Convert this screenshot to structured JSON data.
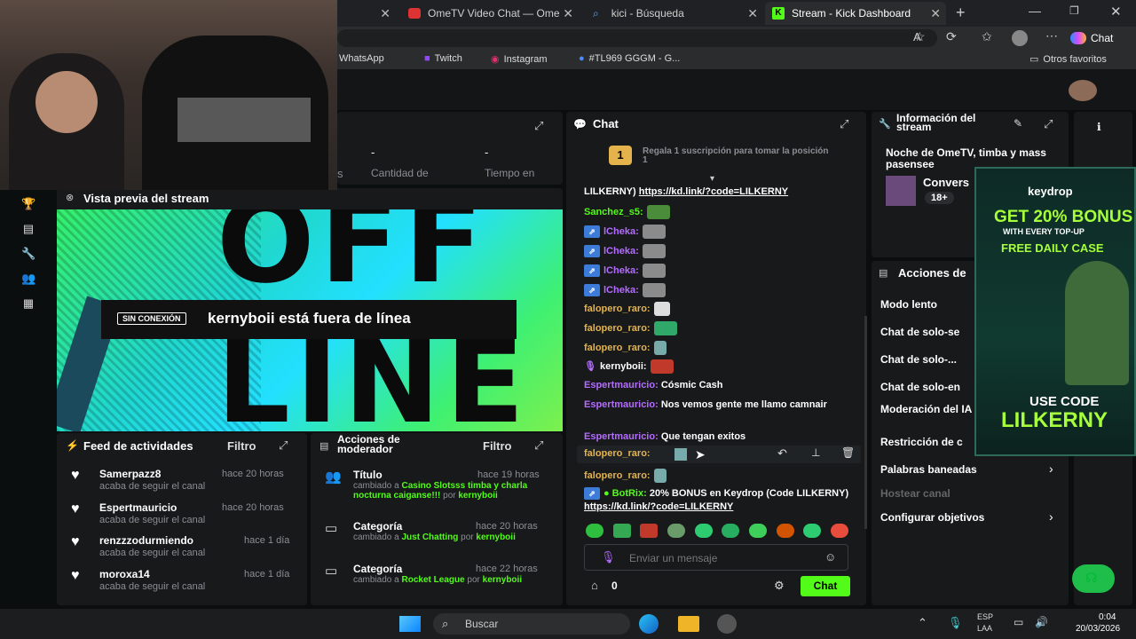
{
  "browser": {
    "tabs": [
      {
        "label": "",
        "active": false
      },
      {
        "label": "OmeTV Video Chat — Ome",
        "active": false
      },
      {
        "label": "kici - Búsqueda",
        "active": false
      },
      {
        "label": "Stream - Kick Dashboard",
        "active": true
      }
    ],
    "new_tab": "+",
    "chat_button": "Chat",
    "bookmarks": [
      "WhatsApp",
      "Twitch",
      "Instagram",
      "#TL969 GGGM - G..."
    ],
    "other_favorites": "Otros favoritos"
  },
  "stats": {
    "col1_suffix": "s",
    "col2_value": "-",
    "col2_label": "Cantidad de",
    "col3_value": "-",
    "col3_label": "Tiempo en"
  },
  "preview": {
    "title": "Vista previa del stream",
    "offline_badge": "SIN CONEXIÓN",
    "offline_text": "kernyboii está fuera de línea",
    "art_top": "OFF",
    "art_bottom": "LINE"
  },
  "feed": {
    "title": "Feed de actividades",
    "filter": "Filtro",
    "items": [
      {
        "user": "Samerpazz8",
        "time": "hace 20 horas",
        "action": "acaba de seguir el canal"
      },
      {
        "user": "Espertmauricio",
        "time": "hace 20 horas",
        "action": "acaba de seguir el canal"
      },
      {
        "user": "renzzzodurmiendo",
        "time": "hace 1 día",
        "action": "acaba de seguir el canal"
      },
      {
        "user": "moroxa14",
        "time": "hace 1 día",
        "action": "acaba de seguir el canal"
      }
    ]
  },
  "modfeed": {
    "title": "Acciones de moderador",
    "filter": "Filtro",
    "items": [
      {
        "type": "Título",
        "time": "hace 19 horas",
        "prefix": "cambiado a",
        "value": "Casino Slotsss timba y charla nocturna caiganse!!!",
        "by": "por",
        "user": "kernyboii"
      },
      {
        "type": "Categoría",
        "time": "hace 20 horas",
        "prefix": "cambiado a",
        "value": "Just Chatting",
        "by": "por",
        "user": "kernyboii"
      },
      {
        "type": "Categoría",
        "time": "hace 22 horas",
        "prefix": "cambiado a",
        "value": "Rocket League",
        "by": "por",
        "user": "kernyboii"
      }
    ]
  },
  "chat": {
    "title": "Chat",
    "gift_number": "1",
    "gift_text": "Regala 1 suscripción para tomar la posición 1",
    "lines": [
      {
        "user": "",
        "text": "LILKERNY)",
        "link": "https://kd.link/?code=LILKERNY",
        "color": "#ffffff"
      },
      {
        "user": "Sanchez_s5:",
        "text": "",
        "link": "",
        "color": "#53fc18"
      },
      {
        "user": "lCheka:",
        "text": "",
        "link": "",
        "color": "#b46cff"
      },
      {
        "user": "lCheka:",
        "text": "",
        "link": "",
        "color": "#b46cff"
      },
      {
        "user": "lCheka:",
        "text": "",
        "link": "",
        "color": "#b46cff"
      },
      {
        "user": "lCheka:",
        "text": "",
        "link": "",
        "color": "#b46cff"
      },
      {
        "user": "falopero_raro:",
        "text": "",
        "link": "",
        "color": "#e4b34b"
      },
      {
        "user": "falopero_raro:",
        "text": "",
        "link": "",
        "color": "#e4b34b"
      },
      {
        "user": "falopero_raro:",
        "text": "",
        "link": "",
        "color": "#e4b34b"
      },
      {
        "user": "kernyboii:",
        "text": "",
        "link": "",
        "color": "#ffffff"
      },
      {
        "user": "Espertmauricio:",
        "text": "Cósmic Cash",
        "link": "",
        "color": "#b46cff"
      },
      {
        "user": "Espertmauricio:",
        "text": "Nos vemos gente me llamo camnair",
        "link": "",
        "color": "#b46cff"
      },
      {
        "user": "Espertmauricio:",
        "text": "Que tengan exitos",
        "link": "",
        "color": "#b46cff"
      },
      {
        "user": "falopero_raro:",
        "text": "",
        "link": "",
        "color": "#e4b34b"
      },
      {
        "user": "falopero_raro:",
        "text": "",
        "link": "",
        "color": "#e4b34b"
      },
      {
        "user": "BotRix:",
        "text": "20% BONUS en Keydrop (Code LILKERNY)",
        "link": "https://kd.link/?code=LILKERNY",
        "color": "#53fc18"
      }
    ],
    "input_placeholder": "Enviar un mensaje",
    "points": "0",
    "send_button": "Chat"
  },
  "info": {
    "title": "Información del stream",
    "stream_title": "Noche de OmeTV, timba y mass pasensee",
    "category": "Convers",
    "tag": "18+"
  },
  "modactions": {
    "title": "Acciones de",
    "items": [
      "Modo lento",
      "Chat de solo-se",
      "Chat de solo-...",
      "Chat de solo-en",
      "Moderación del IA",
      "Restricción de c",
      "Palabras baneadas",
      "Hostear canal",
      "Configurar objetivos"
    ]
  },
  "ad": {
    "brand": "keydrop",
    "line1": "GET 20% BONUS",
    "line2": "WITH EVERY TOP-UP",
    "line3": "FREE DAILY CASE",
    "line4": "USE CODE",
    "code": "LILKERNY"
  },
  "taskbar": {
    "search": "Buscar",
    "lang1": "ESP",
    "lang2": "LAA",
    "time": "0:04",
    "date": "20/03/2026"
  },
  "colors": {
    "kick_green": "#53fc18",
    "panel": "#17191b",
    "background": "#0b0e0f"
  }
}
